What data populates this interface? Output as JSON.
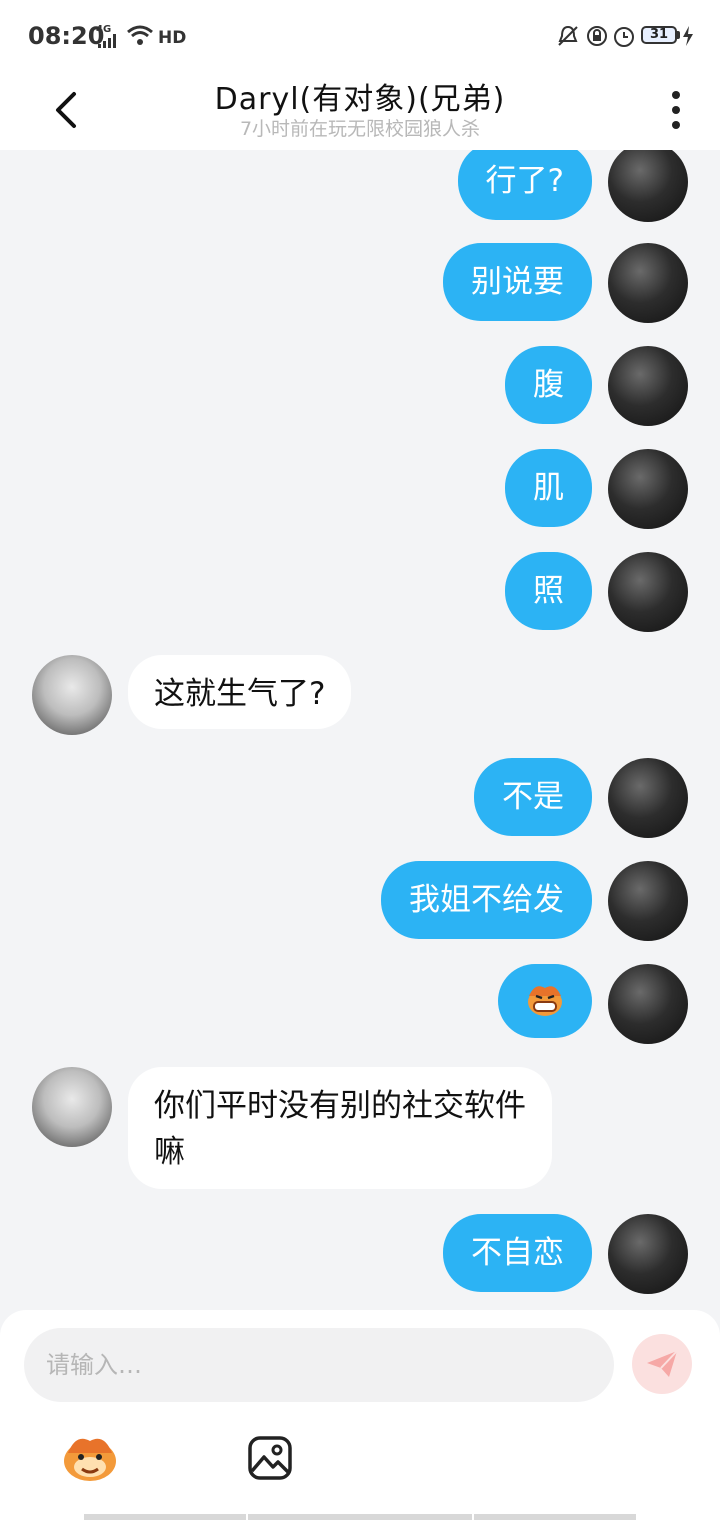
{
  "status_bar": {
    "time": "08:20",
    "network": "4G",
    "hd_label": "HD",
    "battery_level": "31"
  },
  "header": {
    "title": "Daryl(有对象)(兄弟)",
    "subtitle": "7小时前在玩无限校园狼人杀"
  },
  "messages": [
    {
      "from": "me",
      "text": "行了?"
    },
    {
      "from": "me",
      "text": "别说要"
    },
    {
      "from": "me",
      "text": "腹"
    },
    {
      "from": "me",
      "text": "肌"
    },
    {
      "from": "me",
      "text": "照"
    },
    {
      "from": "them",
      "text": "这就生气了?"
    },
    {
      "from": "me",
      "text": "不是"
    },
    {
      "from": "me",
      "text": "我姐不给发"
    },
    {
      "from": "me",
      "text": "",
      "sticker": "grinning-cat-emoji"
    },
    {
      "from": "them",
      "text": "你们平时没有别的社交软件\n嘛"
    },
    {
      "from": "me",
      "text": "不自恋"
    }
  ],
  "composer": {
    "placeholder": "请输入…",
    "value": ""
  },
  "colors": {
    "outgoing_bubble": "#2cb3f4",
    "incoming_bubble": "#ffffff",
    "background": "#f3f4f6",
    "send_button": "#fbe0df"
  },
  "icons": [
    "back-icon",
    "more-icon",
    "send-icon",
    "emoji-icon",
    "image-icon",
    "wifi-icon",
    "signal-icon",
    "mute-icon",
    "lock-icon",
    "alarm-icon",
    "battery-icon",
    "charging-icon"
  ]
}
